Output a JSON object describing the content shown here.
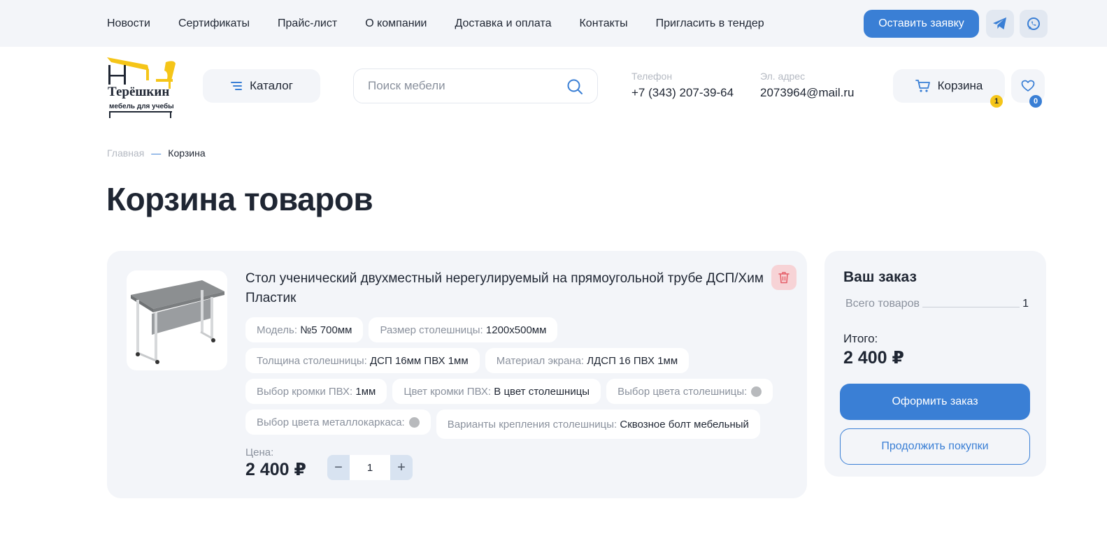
{
  "colors": {
    "accent": "#3a7fd5",
    "panel": "#f3f5f9",
    "badge_cart": "#f5c518",
    "badge_fav": "#3a7fd5",
    "delete_bg": "#f7d3d6",
    "delete_icon": "#e5606a"
  },
  "topnav": {
    "items": [
      {
        "label": "Новости"
      },
      {
        "label": "Сертификаты"
      },
      {
        "label": "Прайс-лист"
      },
      {
        "label": "О компании"
      },
      {
        "label": "Доставка и оплата"
      },
      {
        "label": "Контакты"
      },
      {
        "label": "Пригласить в тендер"
      }
    ],
    "request_label": "Оставить заявку",
    "icons": [
      "telegram-icon",
      "whatsapp-icon"
    ]
  },
  "logo": {
    "line1": "Терёшкин",
    "line2": "мебель для учебы"
  },
  "header": {
    "catalog_label": "Каталог",
    "search_placeholder": "Поиск мебели",
    "phone_label": "Телефон",
    "phone": "+7 (343) 207-39-64",
    "email_label": "Эл. адрес",
    "email": "2073964@mail.ru",
    "cart_label": "Корзина",
    "cart_count": "1",
    "fav_count": "0"
  },
  "breadcrumb": {
    "home": "Главная",
    "separator": "—",
    "current": "Корзина"
  },
  "page_title": "Корзина товаров",
  "cart_item": {
    "name": "Стол ученический двухместный нерегулируемый на прямоугольной трубе ДСП/Хим Пластик",
    "attributes": [
      {
        "key": "Модель:",
        "value": "№5 700мм"
      },
      {
        "key": "Размер столешницы:",
        "value": "1200x500мм"
      },
      {
        "key": "Толщина столешницы:",
        "value": "ДСП 16мм ПВХ 1мм"
      },
      {
        "key": "Материал экрана:",
        "value": "ЛДСП 16 ПВХ 1мм"
      },
      {
        "key": "Выбор кромки ПВХ:",
        "value": "1мм"
      },
      {
        "key": "Цвет кромки ПВХ:",
        "value": "В цвет столешницы"
      },
      {
        "key": "Выбор цвета столешницы:",
        "value": ""
      },
      {
        "key": "Выбор цвета металлокаркаса:",
        "value": ""
      },
      {
        "key": "Варианты крепления столешницы:",
        "value": "Сквозное болт мебельный"
      }
    ],
    "price_label": "Цена:",
    "price": "2 400 ₽",
    "quantity": "1",
    "minus": "−",
    "plus": "+"
  },
  "summary": {
    "title": "Ваш заказ",
    "items_label": "Всего товаров",
    "items_count": "1",
    "total_label": "Итого:",
    "total": "2 400 ₽",
    "order_label": "Оформить заказ",
    "continue_label": "Продолжить покупки"
  }
}
